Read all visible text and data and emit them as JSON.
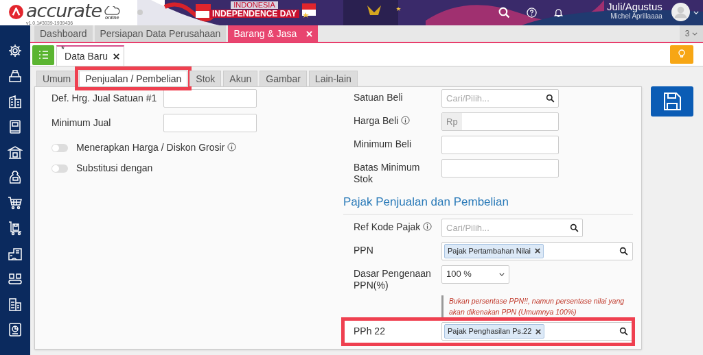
{
  "app": {
    "logo": "accurate",
    "logo_sub": "online",
    "version": "v1.0.1#3039-1939436"
  },
  "banner": {
    "line1": "INDONESIA",
    "line2": "INDEPENDENCE DAY"
  },
  "user": {
    "period": "Juli/Agustus",
    "name": "Michel Aprillaaaa"
  },
  "module_tabs": [
    {
      "label": "Dashboard",
      "selected": false,
      "closable": false
    },
    {
      "label": "Persiapan Data Perusahaan",
      "selected": false,
      "closable": false
    },
    {
      "label": "Barang & Jasa",
      "selected": true,
      "closable": true
    }
  ],
  "tab_count": "3",
  "doc_tab": {
    "label": "Data Baru",
    "modified_mark": "*"
  },
  "form_tabs": [
    {
      "label": "Umum",
      "selected": false,
      "highlighted": false
    },
    {
      "label": "Penjualan / Pembelian",
      "selected": true,
      "highlighted": true
    },
    {
      "label": "Stok",
      "selected": false,
      "highlighted": false
    },
    {
      "label": "Akun",
      "selected": false,
      "highlighted": false
    },
    {
      "label": "Gambar",
      "selected": false,
      "highlighted": false
    },
    {
      "label": "Lain-lain",
      "selected": false,
      "highlighted": false
    }
  ],
  "left_fields": [
    {
      "label": "Def. Hrg. Jual Satuan #1",
      "kind": "text"
    },
    {
      "label": "Minimum Jual",
      "kind": "text"
    }
  ],
  "toggles": [
    {
      "label": "Menerapkan Harga / Diskon Grosir",
      "info": true,
      "on": false
    },
    {
      "label": "Substitusi dengan",
      "info": false,
      "on": false
    }
  ],
  "right_fields": [
    {
      "label": "Satuan Beli",
      "kind": "lookup",
      "placeholder": "Cari/Pilih..."
    },
    {
      "label": "Harga Beli",
      "info": true,
      "kind": "currency",
      "prefix": "Rp"
    },
    {
      "label": "Minimum Beli",
      "kind": "text"
    },
    {
      "label": "Batas Minimum Stok",
      "kind": "text"
    }
  ],
  "tax_section": {
    "title": "Pajak Penjualan dan Pembelian",
    "fields": [
      {
        "label": "Ref Kode Pajak",
        "info": true,
        "kind": "lookup",
        "placeholder": "Cari/Pilih...",
        "highlighted": false
      },
      {
        "label": "PPN",
        "kind": "tag",
        "tag": "Pajak Pertambahan Nilai",
        "highlighted": false
      },
      {
        "label": "Dasar Pengenaan PPN(%)",
        "kind": "select",
        "value": "100 %",
        "note": "Bukan persentase PPN!!, namun persentase nilai yang akan dikenakan PPN (Umumnya 100%)",
        "highlighted": false
      },
      {
        "label": "PPh 22",
        "kind": "tag",
        "tag": "Pajak Penghasilan Ps.22",
        "highlighted": true
      }
    ]
  }
}
